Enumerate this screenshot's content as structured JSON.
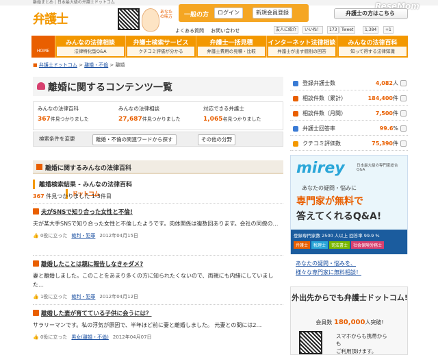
{
  "topbar": "離婚まとめ | 日本最大級の弁護士ドットコム",
  "logo": {
    "main": "弁護士",
    "sub": "ドットコム"
  },
  "mascot_text": "あなたの味方",
  "login": {
    "label": "一般の方",
    "login": "ログイン",
    "register": "新規会員登録"
  },
  "pro_button": "弁護士の方はこちら",
  "links": {
    "faq": "よくある質問",
    "contact": "お問い合わせ"
  },
  "social": {
    "share": "友人に紹介",
    "like": "いいね！",
    "like_count": "173",
    "tweet": "Tweet",
    "tweet_count": "1,384",
    "plus": "+1"
  },
  "nav": {
    "home": "HOME",
    "items": [
      {
        "title": "みんなの法律相談",
        "sub": "法律特化型Q&A"
      },
      {
        "title": "弁護士検索サービス",
        "sub": "クチコミ評価が分かる"
      },
      {
        "title": "弁護士一括見積",
        "sub": "弁護士費用の見積・比較"
      },
      {
        "title": "インターネット法律相談",
        "sub": "弁護士が出す個別の回答"
      },
      {
        "title": "みんなの法律百科",
        "sub": "知って得する法律知識"
      }
    ],
    "new": "NEW"
  },
  "breadcrumb": [
    "弁護士ドットコム",
    "離婚・不倫",
    "離婚"
  ],
  "page_title": "離婚に関するコンテンツ一覧",
  "stats": [
    {
      "label": "みんなの法律百科",
      "count": "367",
      "unit": "件見つかりました"
    },
    {
      "label": "みんなの法律相談",
      "count": "27,687",
      "unit": "件見つかりました"
    },
    {
      "label": "対応できる弁護士",
      "count": "1,065",
      "unit": "名見つかりました"
    }
  ],
  "search": {
    "change": "検索条件を変更",
    "related": "離婚・不倫の関連ワードから探す",
    "other": "その他の分野"
  },
  "section": {
    "title": "離婚に関するみんなの法律百科",
    "subtitle": "離婚検索結果 - みんなの法律百科",
    "count": "367",
    "count_text": "件見つかりました  1-3件目"
  },
  "items": [
    {
      "title": "夫がSNSで知り合った女性と不倫!",
      "desc": "夫が某大手SNSで知り合った女性と不倫したようです。肉体関係は複数回あります。会社の同僚の…",
      "votes": "0",
      "vote_label": "役に立った",
      "tag": "裁判・犯罪",
      "date": "2012年04月15日"
    },
    {
      "title": "離婚したことは親に報告しなきゃダメ?",
      "desc": "妻と離婚しました。このことをあまり多くの方に知られたくないので、両親にも内緒にしていました…",
      "votes": "1",
      "vote_label": "役に立った",
      "tag": "裁判・犯罪",
      "date": "2012年04月12日"
    },
    {
      "title": "離婚した妻が育てている子供に会うには？",
      "desc": "サラリーマンです。私の浮気が原因で、半年ほど前に妻と離婚しました。 元妻との間には2…",
      "votes": "0",
      "vote_label": "役に立った",
      "tag": "男女(離婚・不倫)",
      "date": "2012年04月07日"
    }
  ],
  "right_stats": [
    {
      "label": "登録弁護士数",
      "value": "4,082",
      "unit": "人",
      "color": "#3a7bd5"
    },
    {
      "label": "相談件数（累計）",
      "value": "184,400",
      "unit": "件",
      "color": "#e95f00"
    },
    {
      "label": "相談件数（月間）",
      "value": "7,500",
      "unit": "件",
      "color": "#e95f00"
    },
    {
      "label": "弁護士回答率",
      "value": "99.6",
      "unit": "%",
      "color": "#3a7bd5"
    },
    {
      "label": "クチコミ評価数",
      "value": "75,390",
      "unit": "件",
      "color": "#f39800"
    }
  ],
  "mirey": {
    "logo": "mirey",
    "caption": "日本最大級の専門家総合Q&A",
    "q1": "あなたの疑問・悩みに",
    "q2": "専門家が無料で",
    "q3": "答えてくれるQ&A!",
    "bottom": "登録専門家数 2500 人以上  回答率 99.9 %",
    "chips": [
      "弁護士",
      "税理士",
      "司法書士",
      "社会保険労務士"
    ]
  },
  "right_link": [
    "あなたの疑問・悩みを、",
    "様々な専門家に無料相談！"
  ],
  "phone": {
    "title": "外出先からでも弁護士ドットコム!",
    "members": "会員数",
    "members_count": "180,000",
    "members_unit": "人突破!",
    "note": [
      "スマホからも携帯から",
      "も",
      "ご利用頂けます。"
    ]
  },
  "watermark": "ReseMom"
}
